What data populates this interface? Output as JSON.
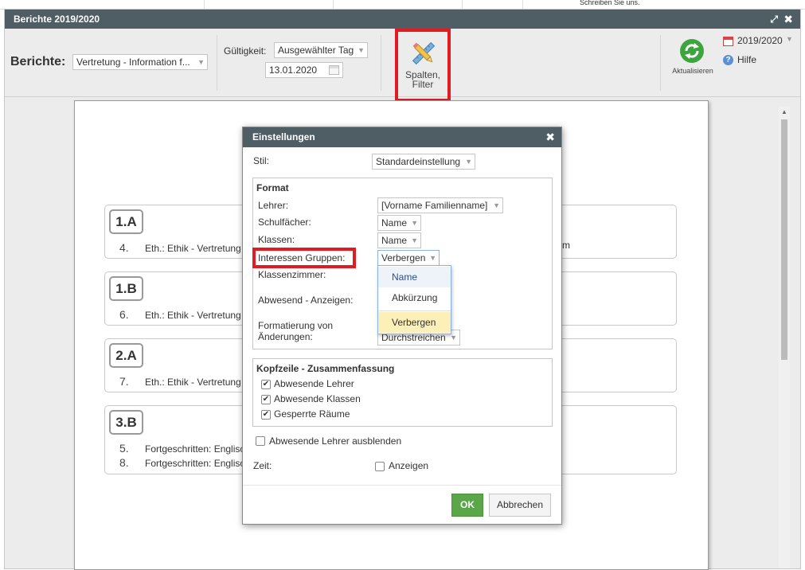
{
  "background": {
    "contact_text": "Schreiben Sie uns."
  },
  "window": {
    "title": "Berichte 2019/2020"
  },
  "toolbar": {
    "reports_label": "Berichte:",
    "report_value": "Vertretung - Information f...",
    "validity_label": "Gültigkeit:",
    "validity_value": "Ausgewählter Tag",
    "date_value": "13.01.2020",
    "columns_filter_label": "Spalten,\nFilter",
    "refresh_label": "Aktualisieren",
    "school_year": "2019/2020",
    "help_label": "Hilfe"
  },
  "report": {
    "classes": [
      {
        "name": "1.A",
        "rows": [
          {
            "num": "4.",
            "text": "Eth.: Ethik - Vertretung"
          }
        ],
        "right_text": "um"
      },
      {
        "name": "1.B",
        "rows": [
          {
            "num": "6.",
            "text": "Eth.: Ethik - Vertretung"
          }
        ]
      },
      {
        "name": "2.A",
        "rows": [
          {
            "num": "7.",
            "text": "Eth.: Ethik - Vertretung"
          }
        ]
      },
      {
        "name": "3.B",
        "rows": [
          {
            "num": "5.",
            "text": "Fortgeschritten: Englisch"
          },
          {
            "num": "8.",
            "text": "Fortgeschritten: Englisch"
          }
        ]
      }
    ]
  },
  "dialog": {
    "title": "Einstellungen",
    "style_label": "Stil:",
    "style_value": "Standardeinstellung",
    "format_title": "Format",
    "teacher_label": "Lehrer:",
    "teacher_value": "[Vorname Familienname]",
    "subjects_label": "Schulfächer:",
    "subjects_value": "Name",
    "classes_label": "Klassen:",
    "classes_value": "Name",
    "interest_groups_label": "Interessen Gruppen:",
    "interest_groups_value": "Verbergen",
    "classroom_label": "Klassenzimmer:",
    "absent_show_label": "Abwesend - Anzeigen:",
    "change_format_label": "Formatierung von\nÄnderungen:",
    "change_format_value": "Durchstreichen",
    "dropdown_options": [
      "Name",
      "Abkürzung",
      "Verbergen"
    ],
    "header_title": "Kopfzeile - Zusammenfassung",
    "header_checks": [
      {
        "label": "Abwesende Lehrer",
        "checked": true
      },
      {
        "label": "Abwesende Klassen",
        "checked": true
      },
      {
        "label": "Gesperrte Räume",
        "checked": true
      }
    ],
    "hide_absent_teachers_label": "Abwesende Lehrer ausblenden",
    "time_label": "Zeit:",
    "time_show_label": "Anzeigen",
    "ok_label": "OK",
    "cancel_label": "Abbrechen"
  },
  "colors": {
    "titlebar": "#4f5d65",
    "highlight_red": "#e11b22",
    "ok_green": "#5aa648",
    "dropdown_selected": "#fdefb8"
  }
}
